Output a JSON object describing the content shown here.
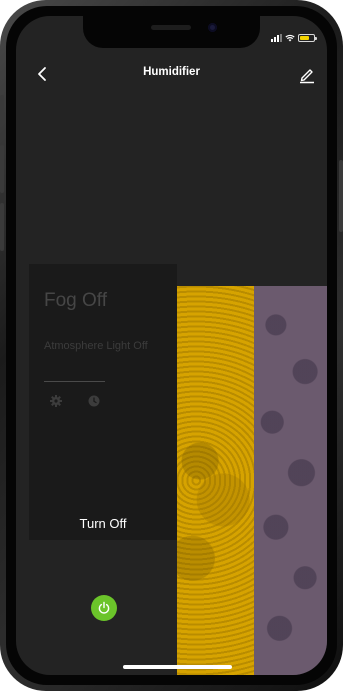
{
  "header": {
    "title": "Humidifier",
    "back_icon": "chevron-left-icon",
    "edit_icon": "pencil-icon"
  },
  "status_bar": {
    "signal_icon": "cellular-signal-icon",
    "wifi_icon": "wifi-icon",
    "battery_icon": "battery-charging-icon"
  },
  "panel": {
    "fog_status": "Fog Off",
    "light_label": "Atmosphere Light Off",
    "settings_icon": "gear-icon",
    "timer_icon": "clock-icon",
    "turn_off_label": "Turn Off"
  },
  "footer": {
    "power_icon": "power-icon"
  },
  "colors": {
    "background": "#232323",
    "power_button": "#6bc42a",
    "battery_fill": "#f5d400",
    "image_yellow": "#cca000",
    "image_purple": "#6b5a6e"
  }
}
